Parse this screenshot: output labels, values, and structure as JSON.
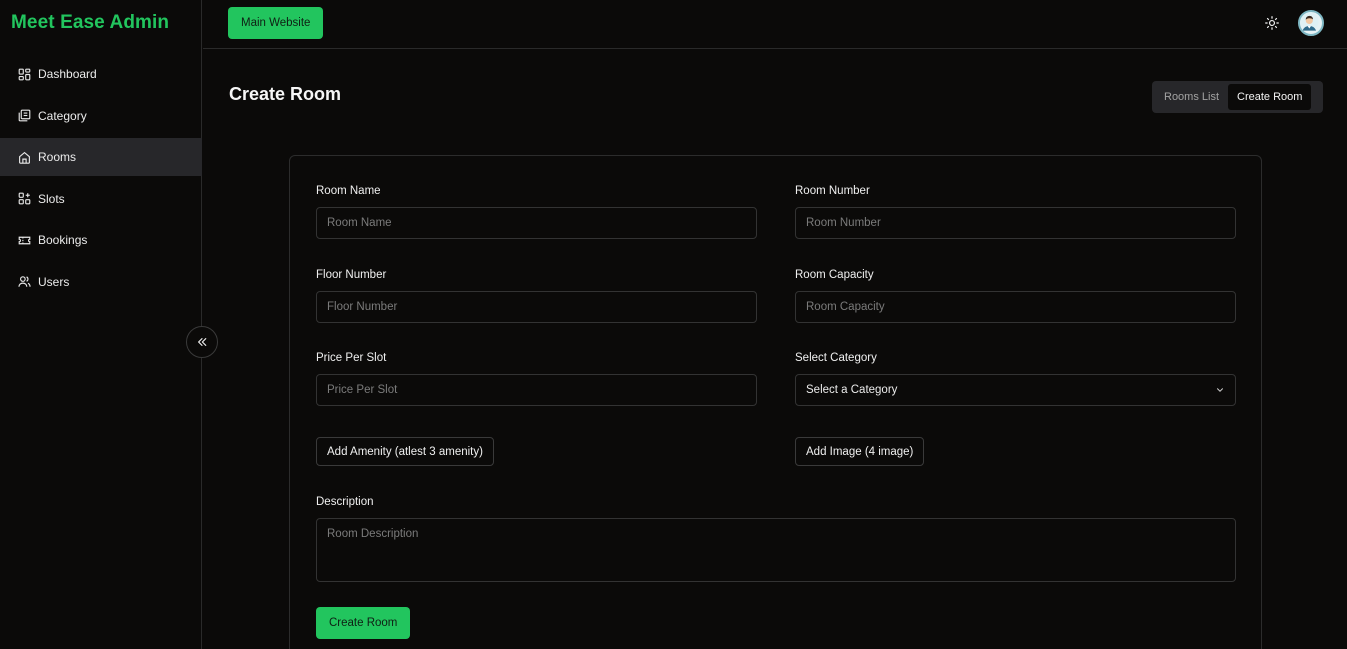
{
  "brand": {
    "title": "Meet Ease Admin"
  },
  "sidebar": {
    "items": [
      {
        "label": "Dashboard",
        "icon": "dashboard-icon",
        "active": false
      },
      {
        "label": "Category",
        "icon": "category-icon",
        "active": false
      },
      {
        "label": "Rooms",
        "icon": "home-icon",
        "active": true
      },
      {
        "label": "Slots",
        "icon": "slots-icon",
        "active": false
      },
      {
        "label": "Bookings",
        "icon": "ticket-icon",
        "active": false
      },
      {
        "label": "Users",
        "icon": "users-icon",
        "active": false
      }
    ]
  },
  "topbar": {
    "main_website_label": "Main Website",
    "theme_icon": "sun-icon",
    "avatar_icon": "user-avatar"
  },
  "page": {
    "title": "Create Room",
    "tabs": [
      {
        "label": "Rooms List",
        "active": false
      },
      {
        "label": "Create Room",
        "active": true
      }
    ]
  },
  "form": {
    "room_name": {
      "label": "Room Name",
      "placeholder": "Room Name",
      "value": ""
    },
    "room_number": {
      "label": "Room Number",
      "placeholder": "Room Number",
      "value": ""
    },
    "floor_number": {
      "label": "Floor Number",
      "placeholder": "Floor Number",
      "value": ""
    },
    "room_capacity": {
      "label": "Room Capacity",
      "placeholder": "Room Capacity",
      "value": ""
    },
    "price_per_slot": {
      "label": "Price Per Slot",
      "placeholder": "Price Per Slot",
      "value": ""
    },
    "category": {
      "label": "Select Category",
      "selected": "Select a Category"
    },
    "add_amenity_label": "Add Amenity (atlest 3 amenity)",
    "add_image_label": "Add Image (4 image)",
    "description": {
      "label": "Description",
      "placeholder": "Room Description",
      "value": ""
    },
    "submit_label": "Create Room"
  },
  "colors": {
    "accent": "#22c55e",
    "background": "#0b0a09",
    "active_nav": "#27272a",
    "border": "#2a2a2a"
  }
}
